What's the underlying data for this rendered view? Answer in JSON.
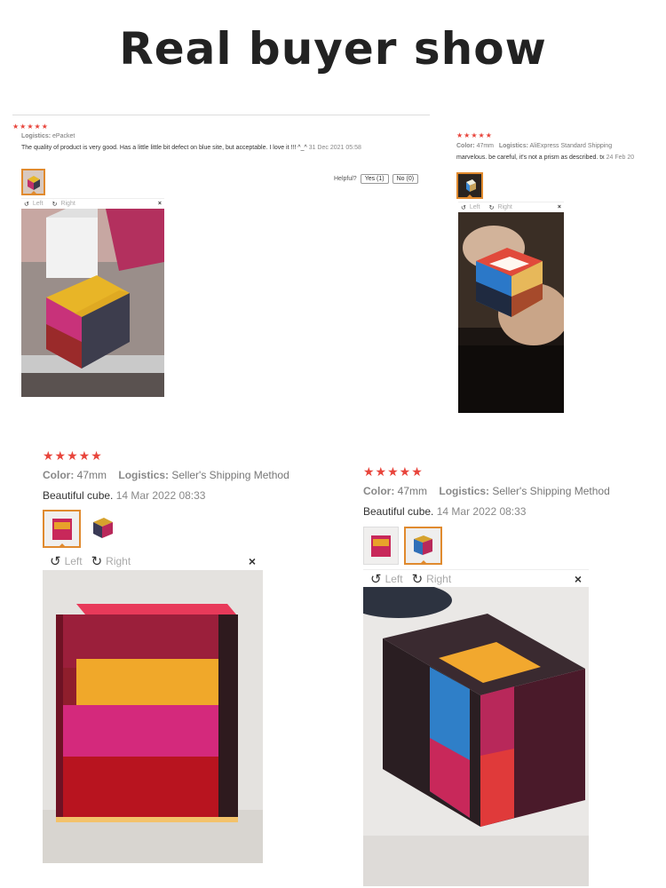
{
  "headline": "Real buyer show",
  "reviews": [
    {
      "stars": "★★★★★",
      "logistics_label": "Logistics:",
      "logistics_value": "ePacket",
      "text": "The quality of product is very good. Has a little little bit defect on blue site, but acceptable. I love it !!! ^_^",
      "date": "31 Dec 2021 05:58",
      "helpful_label": "Helpful?",
      "yes_label": "Yes (1)",
      "no_label": "No (0)",
      "toolbar": {
        "left": "Left",
        "right": "Right",
        "close": "×"
      }
    },
    {
      "stars": "★★★★★",
      "color_label": "Color:",
      "color_value": "47mm",
      "logistics_label": "Logistics:",
      "logistics_value": "AliExpress Standard Shipping",
      "text": "marvelous. be careful, it's not a prism as described. tx",
      "date": "24 Feb 20",
      "toolbar": {
        "left": "Left",
        "right": "Right",
        "close": "×"
      }
    },
    {
      "stars": "★★★★★",
      "color_label": "Color:",
      "color_value": "47mm",
      "logistics_label": "Logistics:",
      "logistics_value": "Seller's Shipping Method",
      "text": "Beautiful cube.",
      "date": "14 Mar 2022 08:33",
      "toolbar": {
        "left": "Left",
        "right": "Right",
        "close": "×"
      }
    },
    {
      "stars": "★★★★★",
      "color_label": "Color:",
      "color_value": "47mm",
      "logistics_label": "Logistics:",
      "logistics_value": "Seller's Shipping Method",
      "text": "Beautiful cube.",
      "date": "14 Mar 2022 08:33",
      "toolbar": {
        "left": "Left",
        "right": "Right",
        "close": "×"
      }
    }
  ],
  "colors": {
    "star": "#e8453c",
    "selected_thumb": "#e08a2e"
  }
}
